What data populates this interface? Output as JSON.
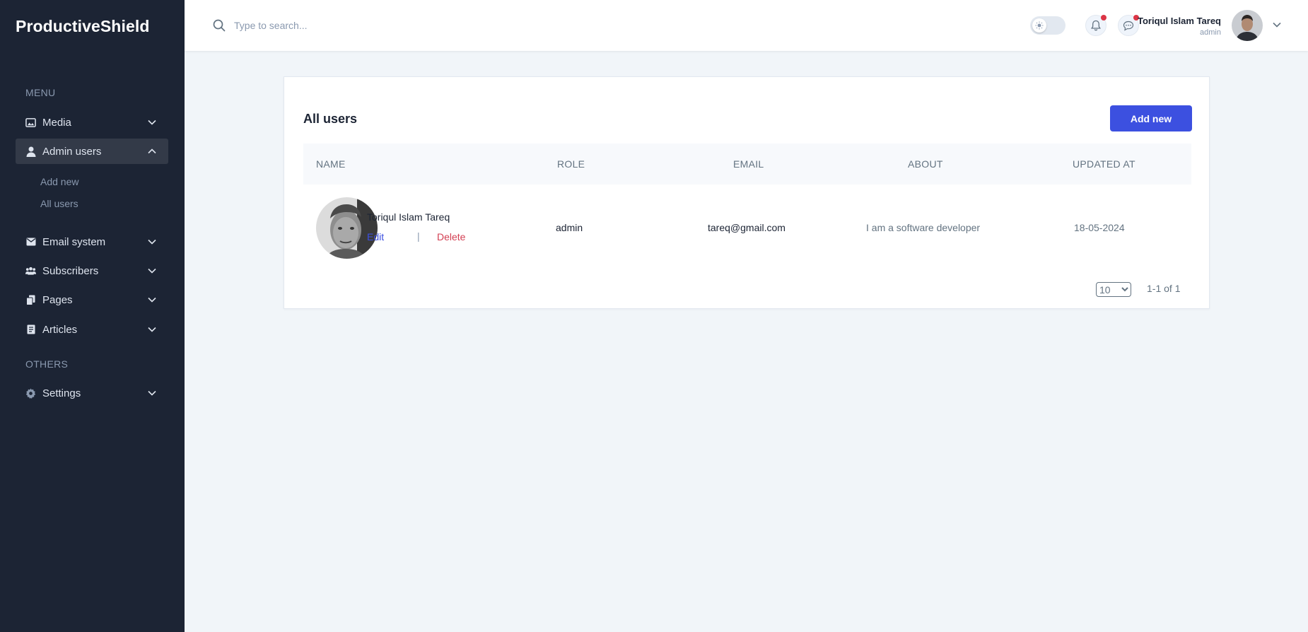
{
  "app": {
    "brand": "ProductiveShield"
  },
  "sidebar": {
    "menu_heading": "MENU",
    "others_heading": "OTHERS",
    "items": [
      {
        "label": "Media",
        "icon": "media-icon"
      },
      {
        "label": "Admin users",
        "icon": "user-icon",
        "active": true,
        "expanded": true
      },
      {
        "label": "Email system",
        "icon": "mail-icon"
      },
      {
        "label": "Subscribers",
        "icon": "users-icon"
      },
      {
        "label": "Pages",
        "icon": "pages-icon"
      },
      {
        "label": "Articles",
        "icon": "article-icon"
      }
    ],
    "submenu": [
      "Add new",
      "All users"
    ],
    "settings": {
      "label": "Settings",
      "icon": "gear-icon"
    }
  },
  "header": {
    "search_placeholder": "Type to search...",
    "user_name": "Toriqul Islam Tareq",
    "user_role": "admin",
    "notification_dot_color": "#dc3545"
  },
  "card": {
    "title": "All users",
    "add_button": "Add new",
    "columns": [
      "NAME",
      "ROLE",
      "EMAIL",
      "ABOUT",
      "UPDATED AT"
    ],
    "rows": [
      {
        "name": "Toriqul Islam Tareq",
        "edit": "Edit",
        "separator": "|",
        "delete": "Delete",
        "role": "admin",
        "email": "tareq@gmail.com",
        "about": "I am a software developer",
        "updated_at": "18-05-2024"
      }
    ],
    "page_size": "10",
    "page_info": "1-1 of 1"
  },
  "colors": {
    "sidebar": "#1c2434",
    "primary": "#3c50e0",
    "danger": "#d34053"
  }
}
